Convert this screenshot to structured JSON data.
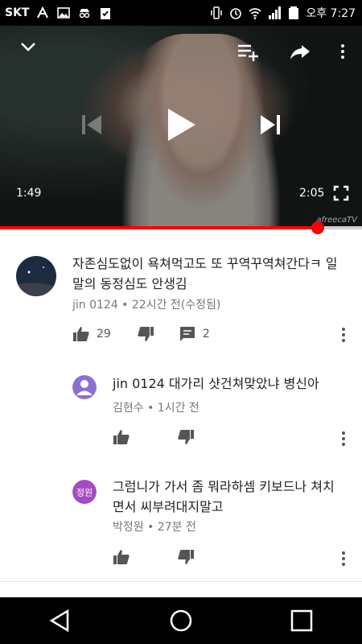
{
  "status_bar": {
    "carrier": "SKT",
    "time": "오후 7:27",
    "icons": [
      "usb-icon",
      "image-icon",
      "spy-icon",
      "clipboard-check-icon",
      "vibrate-icon",
      "alarm-icon",
      "wifi-icon",
      "signal-icon",
      "battery-icon"
    ]
  },
  "video": {
    "current_time": "1:49",
    "total_time": "2:05",
    "progress_fraction": 0.878,
    "watermark": "afreecaTV",
    "accent_color": "#ff0000"
  },
  "comments": [
    {
      "text": "자존심도없이 욕쳐먹고도 또 꾸역꾸역쳐간다ㅋ 일말의 동정심도 안생김",
      "meta": "jin 0124 • 22시간 전(수정됨)",
      "likes": "29",
      "replies": "2"
    },
    {
      "text": "jin 0124 대가리 샷건쳐맞았냐 병신아",
      "meta": "김현수 • 1시간 전",
      "avatar_color": "#8e6fd1"
    },
    {
      "text": "그럼니가 가서 좀 뭐라하셈 키보드나 쳐치면서 씨부려대지말고",
      "meta": "박정원 • 27분 전",
      "avatar_label": "정원",
      "avatar_color": "#a64cc0"
    }
  ]
}
